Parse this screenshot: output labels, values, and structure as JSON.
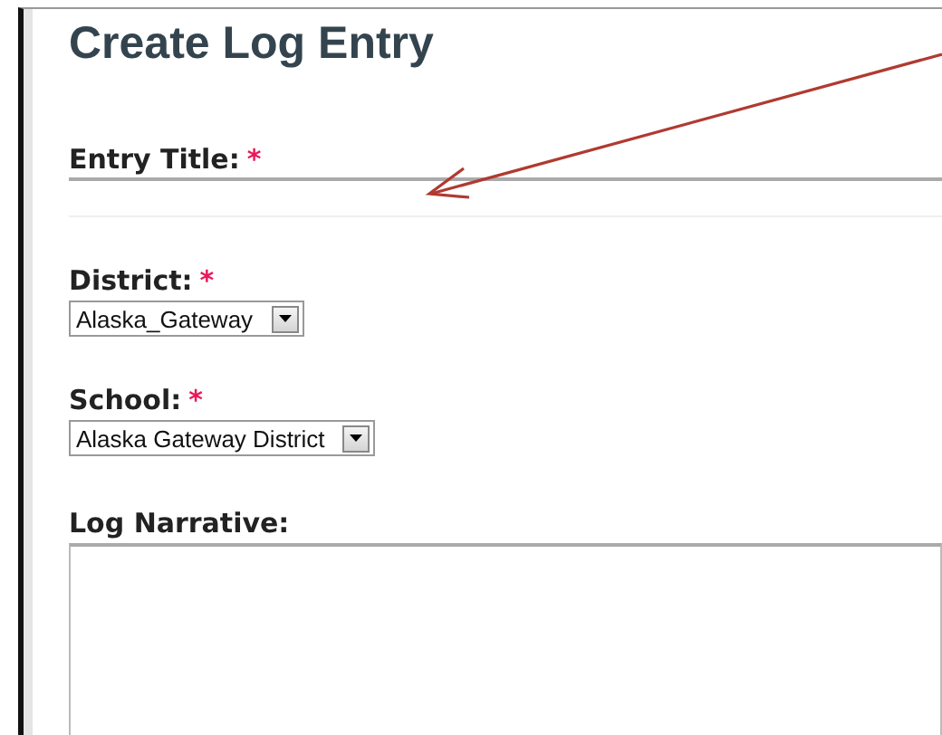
{
  "title": "Create Log Entry",
  "fields": [
    {
      "kind": "text",
      "label": "Entry Title:",
      "required_mark": "*"
    },
    {
      "kind": "select",
      "label": "District:",
      "required_mark": "*",
      "value": "Alaska_Gateway"
    },
    {
      "kind": "select",
      "label": "School:",
      "required_mark": "*",
      "value": "Alaska Gateway District"
    },
    {
      "kind": "textarea",
      "label": "Log Narrative:"
    }
  ]
}
